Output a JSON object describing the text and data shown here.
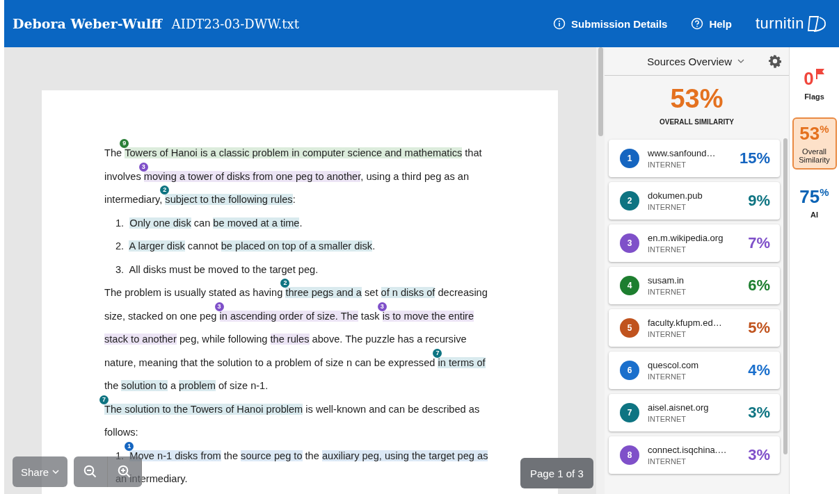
{
  "header": {
    "author": "Debora Weber-Wulff",
    "filename": "AIDT23-03-DWW.txt",
    "links": [
      {
        "kind": "info",
        "label": "Submission Details"
      },
      {
        "kind": "help",
        "label": "Help"
      }
    ],
    "logo": "turnitin"
  },
  "document": {
    "paragraphs": [
      {
        "kind": "para",
        "segments": [
          {
            "text": "The "
          },
          {
            "text": "Towers of Hanoi is a classic problem in computer science and mathematics",
            "color": "#dcecdc",
            "marker": {
              "label": "9",
              "color": "#2a7f37"
            }
          },
          {
            "text": " that involves "
          },
          {
            "text": "moving a tower of disks from one peg to another",
            "color": "#ece4f5",
            "marker": {
              "label": "3",
              "color": "#7f50c9"
            }
          },
          {
            "text": ", using a third peg as an intermediary, "
          },
          {
            "text": "subject to the following rules",
            "color": "#d9eaee",
            "marker": {
              "label": "2",
              "color": "#0e7482"
            }
          },
          {
            "text": ":"
          }
        ]
      },
      {
        "kind": "list_item",
        "number": "1.",
        "segments": [
          {
            "text": "Only one disk",
            "color": "#d9eaee"
          },
          {
            "text": " can "
          },
          {
            "text": "be moved at a time",
            "color": "#d9eaee"
          },
          {
            "text": "."
          }
        ]
      },
      {
        "kind": "list_item",
        "number": "2.",
        "segments": [
          {
            "text": "A larger disk",
            "color": "#d9eaee"
          },
          {
            "text": " cannot "
          },
          {
            "text": "be placed on top of a smaller disk",
            "color": "#d9eaee"
          },
          {
            "text": "."
          }
        ]
      },
      {
        "kind": "list_item",
        "number": "3.",
        "segments": [
          {
            "text": "All disks must be moved to the target peg."
          }
        ]
      },
      {
        "kind": "para",
        "segments": [
          {
            "text": "The problem is usually stated as having "
          },
          {
            "text": "three pegs and a",
            "color": "#d9eaee",
            "marker": {
              "label": "2",
              "color": "#0e7482"
            }
          },
          {
            "text": " set "
          },
          {
            "text": "of n disks of",
            "color": "#d9eaee"
          },
          {
            "text": " decreasing size, stacked on one peg "
          },
          {
            "text": "in ascending order of size. The",
            "color": "#ece4f5",
            "marker": {
              "label": "3",
              "color": "#7f50c9"
            }
          },
          {
            "text": " task "
          },
          {
            "text": "is to move the entire ",
            "color": "#ece4f5",
            "marker": {
              "label": "3",
              "color": "#7f50c9"
            }
          },
          {
            "text": "stack to another",
            "color": "#ece4f5"
          },
          {
            "text": " peg, while following "
          },
          {
            "text": "the rules",
            "color": "#ece4f5"
          },
          {
            "text": " above. The puzzle has a recursive nature, meaning that the solution to a problem of size n can be expressed "
          },
          {
            "text": "in terms of",
            "color": "#d9eaee",
            "marker": {
              "label": "7",
              "color": "#0e7482"
            }
          },
          {
            "text": " the "
          },
          {
            "text": "solution to",
            "color": "#d9eaee"
          },
          {
            "text": " a "
          },
          {
            "text": "problem",
            "color": "#d9eaee"
          },
          {
            "text": " of size n-1."
          }
        ]
      },
      {
        "kind": "para",
        "segments": [
          {
            "text": "The solution to the Towers of Hanoi problem",
            "color": "#d9eaee",
            "marker": {
              "label": "7",
              "color": "#0e7482"
            }
          },
          {
            "text": " is well-known and can be described as follows:"
          }
        ]
      },
      {
        "kind": "list_item",
        "number": "1.",
        "segments": [
          {
            "text": "Move n-1 disks from",
            "color": "#dbe8f5",
            "marker": {
              "label": "1",
              "color": "#1565c0"
            }
          },
          {
            "text": " the "
          },
          {
            "text": "source peg to",
            "color": "#dbe8f5"
          },
          {
            "text": " the "
          },
          {
            "text": "auxiliary peg, using the target peg as",
            "color": "#dbe8f5"
          },
          {
            "text": " an intermediary."
          }
        ]
      }
    ]
  },
  "toolbar": {
    "share": "Share",
    "page": "Page 1 of 3"
  },
  "sources": {
    "title": "Sources Overview",
    "overall": "53%",
    "overall_label": "OVERALL SIMILARITY",
    "items": [
      {
        "number": "1",
        "name": "www.sanfound…",
        "type": "INTERNET",
        "percent": "15%",
        "color": "#1565c0"
      },
      {
        "number": "2",
        "name": "dokumen.pub",
        "type": "INTERNET",
        "percent": "9%",
        "color": "#0e7482"
      },
      {
        "number": "3",
        "name": "en.m.wikipedia.org",
        "type": "INTERNET",
        "percent": "7%",
        "color": "#7f50c9"
      },
      {
        "number": "4",
        "name": "susam.in",
        "type": "INTERNET",
        "percent": "6%",
        "color": "#1d7e2f"
      },
      {
        "number": "5",
        "name": "faculty.kfupm.ed…",
        "type": "INTERNET",
        "percent": "5%",
        "color": "#c0531e"
      },
      {
        "number": "6",
        "name": "quescol.com",
        "type": "INTERNET",
        "percent": "4%",
        "color": "#1a6fcc"
      },
      {
        "number": "7",
        "name": "aisel.aisnet.org",
        "type": "INTERNET",
        "percent": "3%",
        "color": "#0e7482"
      },
      {
        "number": "8",
        "name": "connect.isqchina.…",
        "type": "INTERNET",
        "percent": "3%",
        "color": "#7f50c9"
      }
    ]
  },
  "rail": [
    {
      "kind": "flags",
      "value": "0",
      "label": "Flags",
      "selected": false
    },
    {
      "kind": "similarity",
      "value": "53$^{%}$",
      "label": "Overall Similarity",
      "selected": true
    },
    {
      "kind": "ai",
      "value": "75$^{%}$",
      "label": "AI",
      "selected": false
    }
  ]
}
